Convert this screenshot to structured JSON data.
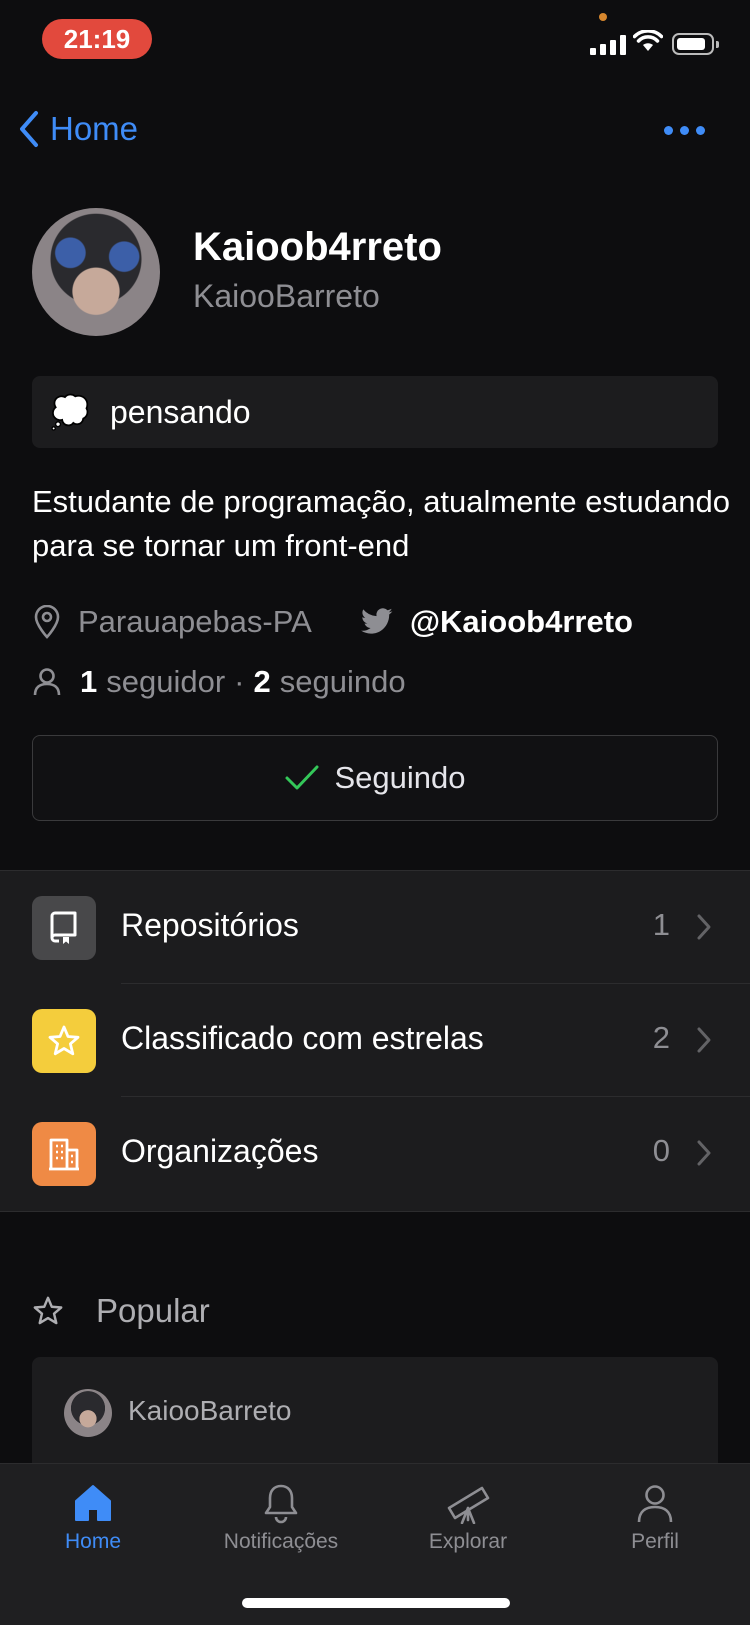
{
  "status_bar": {
    "time": "21:19"
  },
  "nav": {
    "back_label": "Home"
  },
  "profile": {
    "display_name": "Kaioob4rreto",
    "username": "KaiooBarreto",
    "status_emoji": "💭",
    "status_text": "pensando",
    "bio": "Estudante de programação, atualmente estudando para se tornar  um front-end",
    "location": "Parauapebas-PA",
    "twitter": "@Kaioob4rreto",
    "followers_count": "1",
    "followers_label": "seguidor",
    "separator": "·",
    "following_count": "2",
    "following_label": "seguindo"
  },
  "follow_button": {
    "label": "Seguindo"
  },
  "sections": [
    {
      "label": "Repositórios",
      "count": "1",
      "icon": "repo-icon",
      "color": "#48484a"
    },
    {
      "label": "Classificado com estrelas",
      "count": "2",
      "icon": "star-icon",
      "color": "#f4cd3c"
    },
    {
      "label": "Organizações",
      "count": "0",
      "icon": "building-icon",
      "color": "#ef8a45"
    }
  ],
  "popular": {
    "title": "Popular",
    "card_owner": "KaiooBarreto"
  },
  "tabs": [
    {
      "label": "Home",
      "icon": "home-icon",
      "active": true
    },
    {
      "label": "Notificações",
      "icon": "bell-icon",
      "active": false
    },
    {
      "label": "Explorar",
      "icon": "telescope-icon",
      "active": false
    },
    {
      "label": "Perfil",
      "icon": "person-icon",
      "active": false
    }
  ],
  "colors": {
    "accent": "#3f8cf7",
    "check": "#34c759",
    "time_pill": "#e2493d"
  }
}
